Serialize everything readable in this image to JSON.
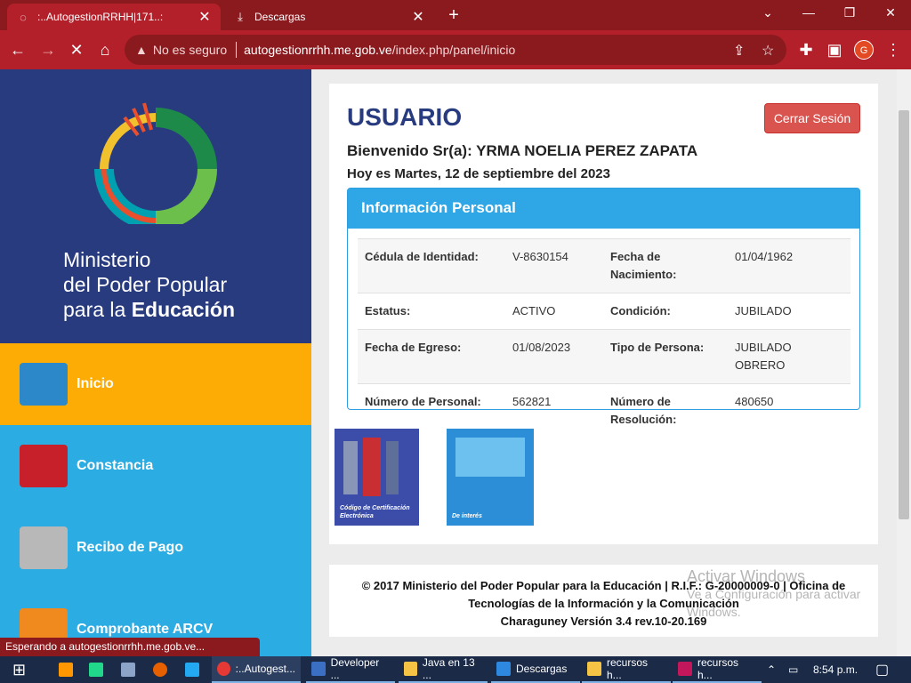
{
  "browser": {
    "tabs": [
      {
        "title": ":..AutogestionRRHH|171..:",
        "close": "✕"
      },
      {
        "title": "Descargas",
        "close": "✕"
      }
    ],
    "new_tab": "+",
    "window_controls": [
      "⌄",
      "—",
      "❐",
      "✕"
    ],
    "security_label": "No es seguro",
    "url_host": "autogestionrrhh.me.gob.ve",
    "url_path": "/index.php/panel/inicio",
    "profile_initial": "G"
  },
  "sidebar": {
    "ministry_line1": "Ministerio",
    "ministry_line2": "del Poder Popular",
    "ministry_line3a": "para la ",
    "ministry_line3b": "Educación",
    "items": [
      {
        "label": "Inicio"
      },
      {
        "label": "Constancia"
      },
      {
        "label": "Recibo de Pago"
      },
      {
        "label": "Comprobante ARCV"
      }
    ]
  },
  "panel": {
    "title": "USUARIO",
    "logout_label": "Cerrar Sesión",
    "welcome": "Bienvenido Sr(a): YRMA NOELIA PEREZ ZAPATA",
    "date": "Hoy es Martes, 12 de septiembre del 2023",
    "info_title": "Información Personal",
    "rows": [
      {
        "l1": "Cédula de Identidad:",
        "v1": "V-8630154",
        "l2": "Fecha de Nacimiento:",
        "v2": "01/04/1962"
      },
      {
        "l1": "Estatus:",
        "v1": "ACTIVO",
        "l2": "Condición:",
        "v2": "JUBILADO"
      },
      {
        "l1": "Fecha de Egreso:",
        "v1": "01/08/2023",
        "l2": "Tipo de Persona:",
        "v2": "JUBILADO OBRERO"
      },
      {
        "l1": "Número de Personal:",
        "v1": "562821",
        "l2": "Número de Resolución:",
        "v2": "480650"
      }
    ],
    "thumb1_label": "Código de Certificación Electrónica",
    "thumb2_label": "De interés"
  },
  "footer": {
    "line1": "© 2017 Ministerio del Poder Popular para la Educación | R.I.F.: G-20000009-0 | Oficina de",
    "line2": "Tecnologías de la Información y la Comunicación",
    "line3": "Charaguney Versión 3.4 rev.10-20.169"
  },
  "windows_watermark": {
    "line1": "Activar Windows",
    "line2": "Ve a Configuración para activar",
    "line3": "Windows."
  },
  "status_text": "Esperando a autogestionrrhh.me.gob.ve...",
  "taskbar": {
    "items": [
      {
        "label": ":..Autogest..."
      },
      {
        "label": "Developer ..."
      },
      {
        "label": "Java en 13 ..."
      },
      {
        "label": "Descargas"
      },
      {
        "label": "recursos h..."
      },
      {
        "label": "recursos h..."
      }
    ],
    "clock": "8:54 p.m."
  }
}
